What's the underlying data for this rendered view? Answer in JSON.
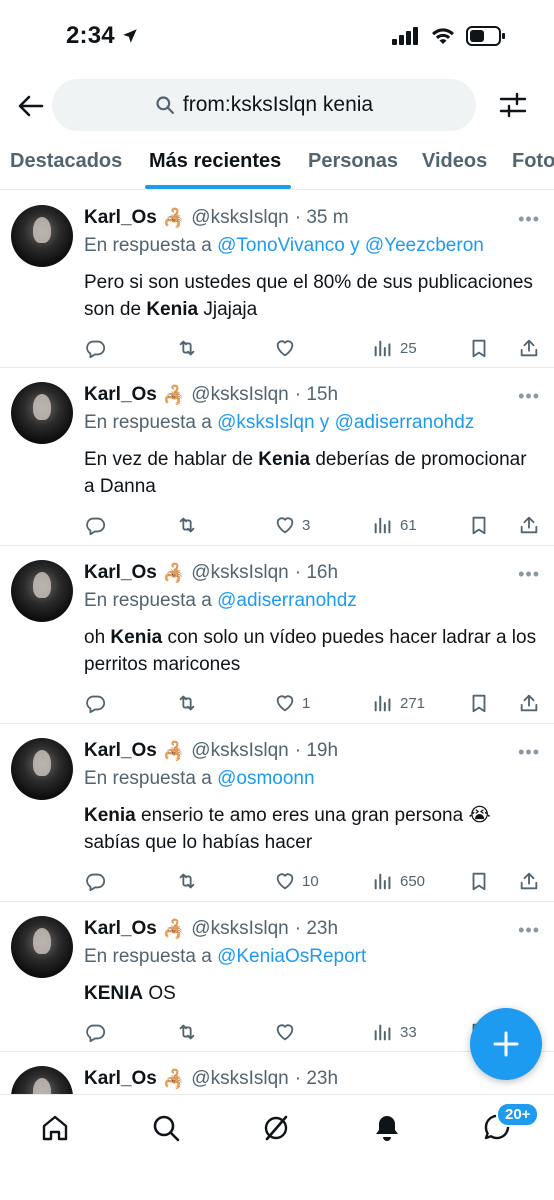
{
  "status_bar": {
    "time": "2:34"
  },
  "search": {
    "query": "from:ksksIslqn kenia"
  },
  "tabs": [
    {
      "label": "Destacados",
      "active": false
    },
    {
      "label": "Más recientes",
      "active": true
    },
    {
      "label": "Personas",
      "active": false
    },
    {
      "label": "Videos",
      "active": false
    },
    {
      "label": "Fotos",
      "active": false
    }
  ],
  "colors": {
    "accent": "#1d9bf0",
    "secondary_text": "#536471",
    "divider": "#e7e9ea"
  },
  "tweets": [
    {
      "name": "Karl_Os",
      "handle": "@ksksIslqn",
      "time": "· 35 m",
      "reply_prefix": "En respuesta a",
      "reply_to": "@TonoVivanco y @Yeezcberon",
      "text_html": "Pero si son ustedes que el 80% de sus publicaciones son de <b>Kenia</b> Jjajaja",
      "likes": "",
      "views": "25"
    },
    {
      "name": "Karl_Os",
      "handle": "@ksksIslqn",
      "time": "· 15h",
      "reply_prefix": "En respuesta a",
      "reply_to": "@ksksIslqn y @adiserranohdz",
      "text_html": "En vez de hablar de <b>Kenia</b> deberías de promocionar a Danna",
      "likes": "3",
      "views": "61"
    },
    {
      "name": "Karl_Os",
      "handle": "@ksksIslqn",
      "time": "· 16h",
      "reply_prefix": "En respuesta a",
      "reply_to": "@adiserranohdz",
      "text_html": "oh <b>Kenia</b> con solo un vídeo puedes hacer ladrar a los perritos maricones",
      "likes": "1",
      "views": "271"
    },
    {
      "name": "Karl_Os",
      "handle": "@ksksIslqn",
      "time": "· 19h",
      "reply_prefix": "En respuesta a",
      "reply_to": "@osmoonn",
      "text_html": "<b>Kenia</b> enserio te amo eres una gran persona 😭 sabías que lo habías hacer",
      "likes": "10",
      "views": "650"
    },
    {
      "name": "Karl_Os",
      "handle": "@ksksIslqn",
      "time": "· 23h",
      "reply_prefix": "En respuesta a",
      "reply_to": "@KeniaOsReport",
      "text_html": "<b>KENIA</b> OS",
      "likes": "",
      "views": "33"
    },
    {
      "name": "Karl_Os",
      "handle": "@ksksIslqn",
      "time": "· 23h"
    }
  ],
  "nav": {
    "messages_badge": "20+"
  },
  "icons": [
    "back-arrow-icon",
    "search-icon",
    "filter-icon",
    "reply-icon",
    "retweet-icon",
    "like-icon",
    "views-icon",
    "bookmark-icon",
    "share-icon",
    "compose-icon",
    "home-icon",
    "explore-icon",
    "grok-icon",
    "notifications-icon",
    "messages-icon"
  ]
}
